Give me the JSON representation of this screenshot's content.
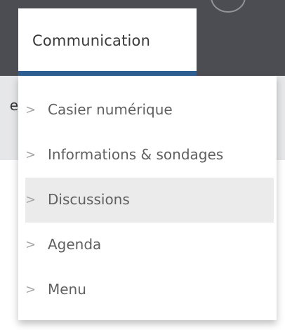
{
  "tab": {
    "label": "Communication"
  },
  "edge_text": "e",
  "menu": {
    "chevron": ">",
    "items": [
      {
        "label": "Casier numérique"
      },
      {
        "label": "Informations & sondages"
      },
      {
        "label": "Discussions"
      },
      {
        "label": "Agenda"
      },
      {
        "label": "Menu"
      }
    ],
    "highlighted_item": "Discussions"
  },
  "colors": {
    "accent": "#2f5f92",
    "topbar": "#4b4d52",
    "highlight": "#ebebeb",
    "text": "#606060"
  }
}
